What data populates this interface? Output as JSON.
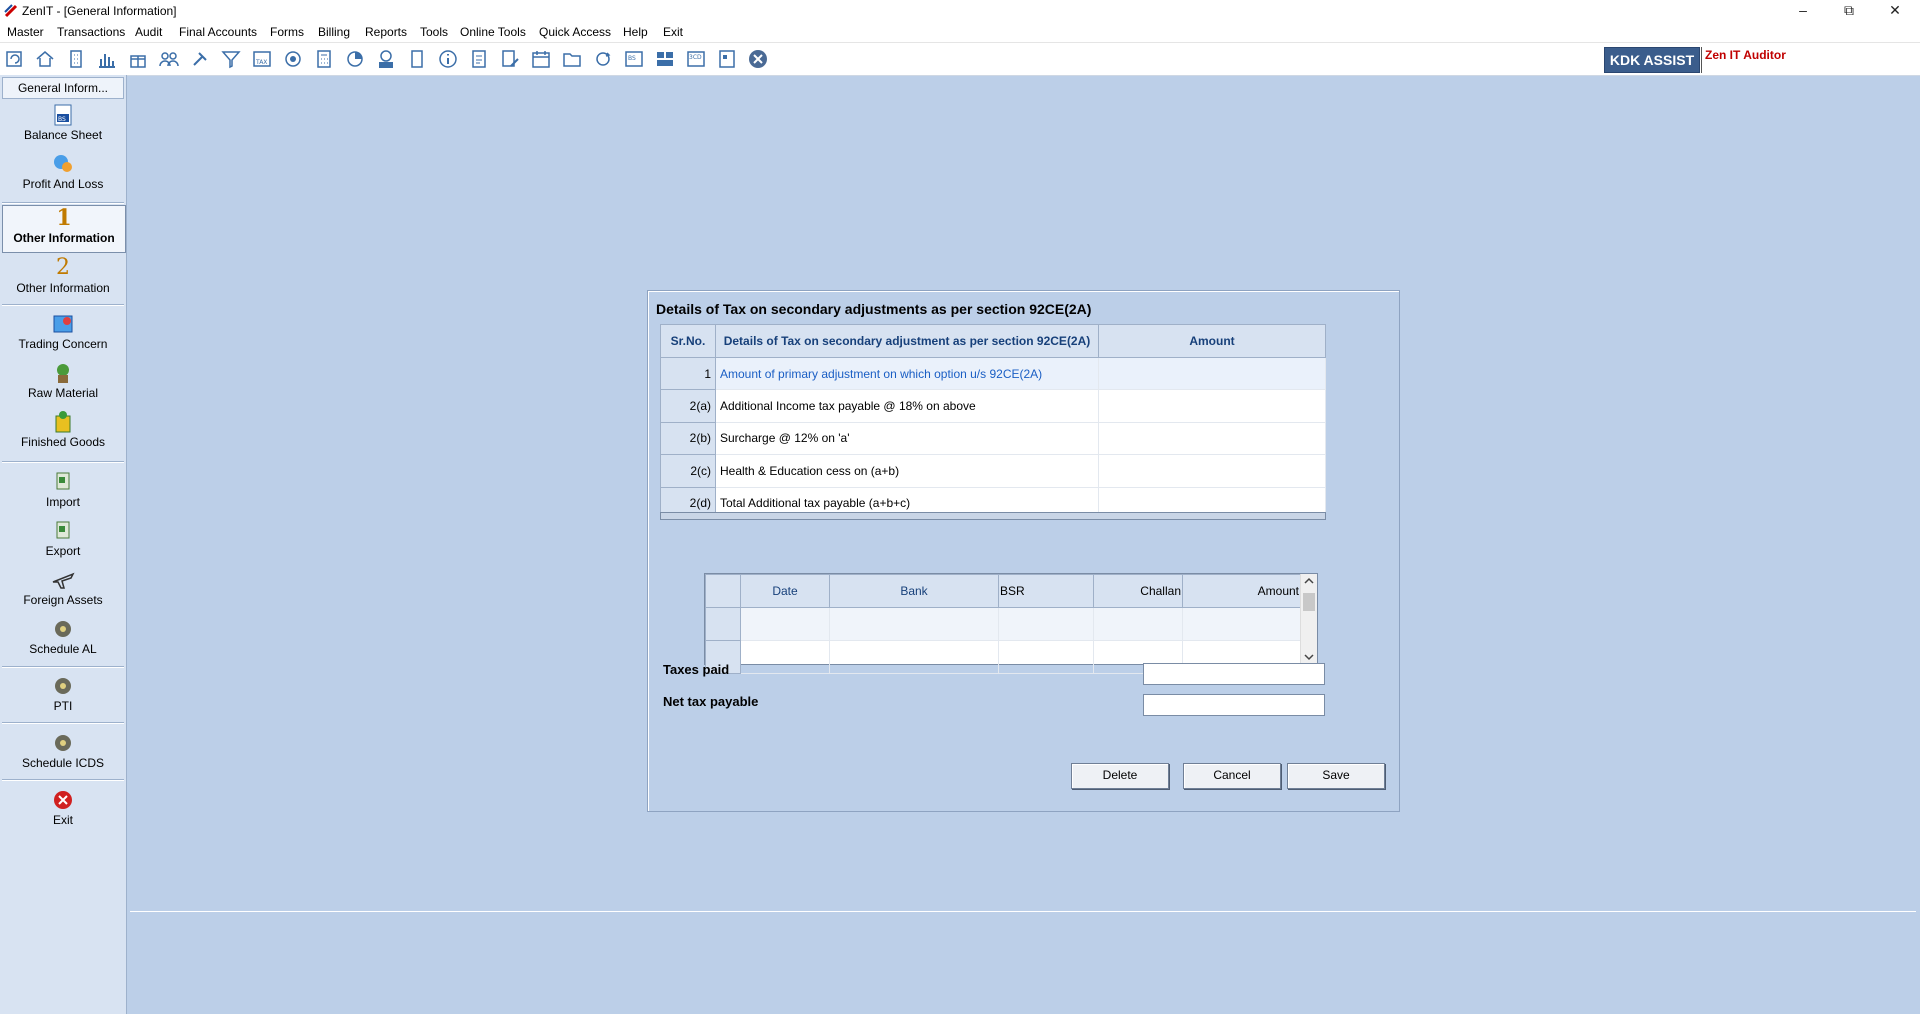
{
  "window": {
    "title": "ZenIT - [General Information]"
  },
  "menu": [
    "Master",
    "Transactions",
    "Audit",
    "Final Accounts",
    "Forms",
    "Billing",
    "Reports",
    "Tools",
    "Online Tools",
    "Quick Access",
    "Help",
    "Exit"
  ],
  "toolbar": {
    "kdk_label": "KDK ASSIST",
    "auditor_label": "Zen IT Auditor"
  },
  "sidebar": {
    "header": "General Inform...",
    "items": [
      {
        "label": "Balance Sheet",
        "icon": "balance-sheet-icon"
      },
      {
        "label": "Profit And Loss",
        "icon": "profit-loss-icon"
      },
      {
        "label": "Other Information",
        "icon": "number-1-icon",
        "num": "1"
      },
      {
        "label": "Other Information",
        "icon": "number-2-icon",
        "num": "2"
      },
      {
        "label": "Trading Concern",
        "icon": "trading-concern-icon"
      },
      {
        "label": "Raw Material",
        "icon": "raw-material-icon"
      },
      {
        "label": "Finished Goods",
        "icon": "finished-goods-icon"
      },
      {
        "label": "Import",
        "icon": "import-icon"
      },
      {
        "label": "Export",
        "icon": "export-icon"
      },
      {
        "label": "Foreign Assets",
        "icon": "airplane-icon"
      },
      {
        "label": "Schedule AL",
        "icon": "schedule-al-icon"
      },
      {
        "label": "PTI",
        "icon": "pti-icon"
      },
      {
        "label": "Schedule ICDS",
        "icon": "schedule-icds-icon"
      },
      {
        "label": "Exit",
        "icon": "exit-icon"
      }
    ]
  },
  "dialog": {
    "title": "Details of Tax on secondary adjustments as per section 92CE(2A)",
    "table": {
      "headers": [
        "Sr.No.",
        "Details of Tax on secondary adjustment as per section 92CE(2A)",
        "Amount"
      ],
      "rows": [
        {
          "sr": "1",
          "desc": "Amount of primary adjustment on which option u/s 92CE(2A)",
          "amount": ""
        },
        {
          "sr": "2(a)",
          "desc": "Additional Income tax payable @ 18% on above",
          "amount": ""
        },
        {
          "sr": "2(b)",
          "desc": "Surcharge @ 12% on 'a'",
          "amount": ""
        },
        {
          "sr": "2(c)",
          "desc": "Health & Education cess on (a+b)",
          "amount": ""
        },
        {
          "sr": "2(d)",
          "desc": "Total Additional tax payable (a+b+c)",
          "amount": ""
        }
      ]
    },
    "challan_headers": [
      "Date",
      "Bank",
      "BSR",
      "Challan",
      "Amount"
    ],
    "taxes_paid_label": "Taxes paid",
    "net_tax_label": "Net tax payable",
    "taxes_paid_value": "",
    "net_tax_value": "",
    "buttons": {
      "delete": "Delete",
      "cancel": "Cancel",
      "save": "Save"
    }
  },
  "colors": {
    "background": "#bccfe8",
    "header_text": "#17407a",
    "link_row": "#1a5ec4",
    "kdk": "#3b5d8c",
    "auditor": "#c00000"
  }
}
